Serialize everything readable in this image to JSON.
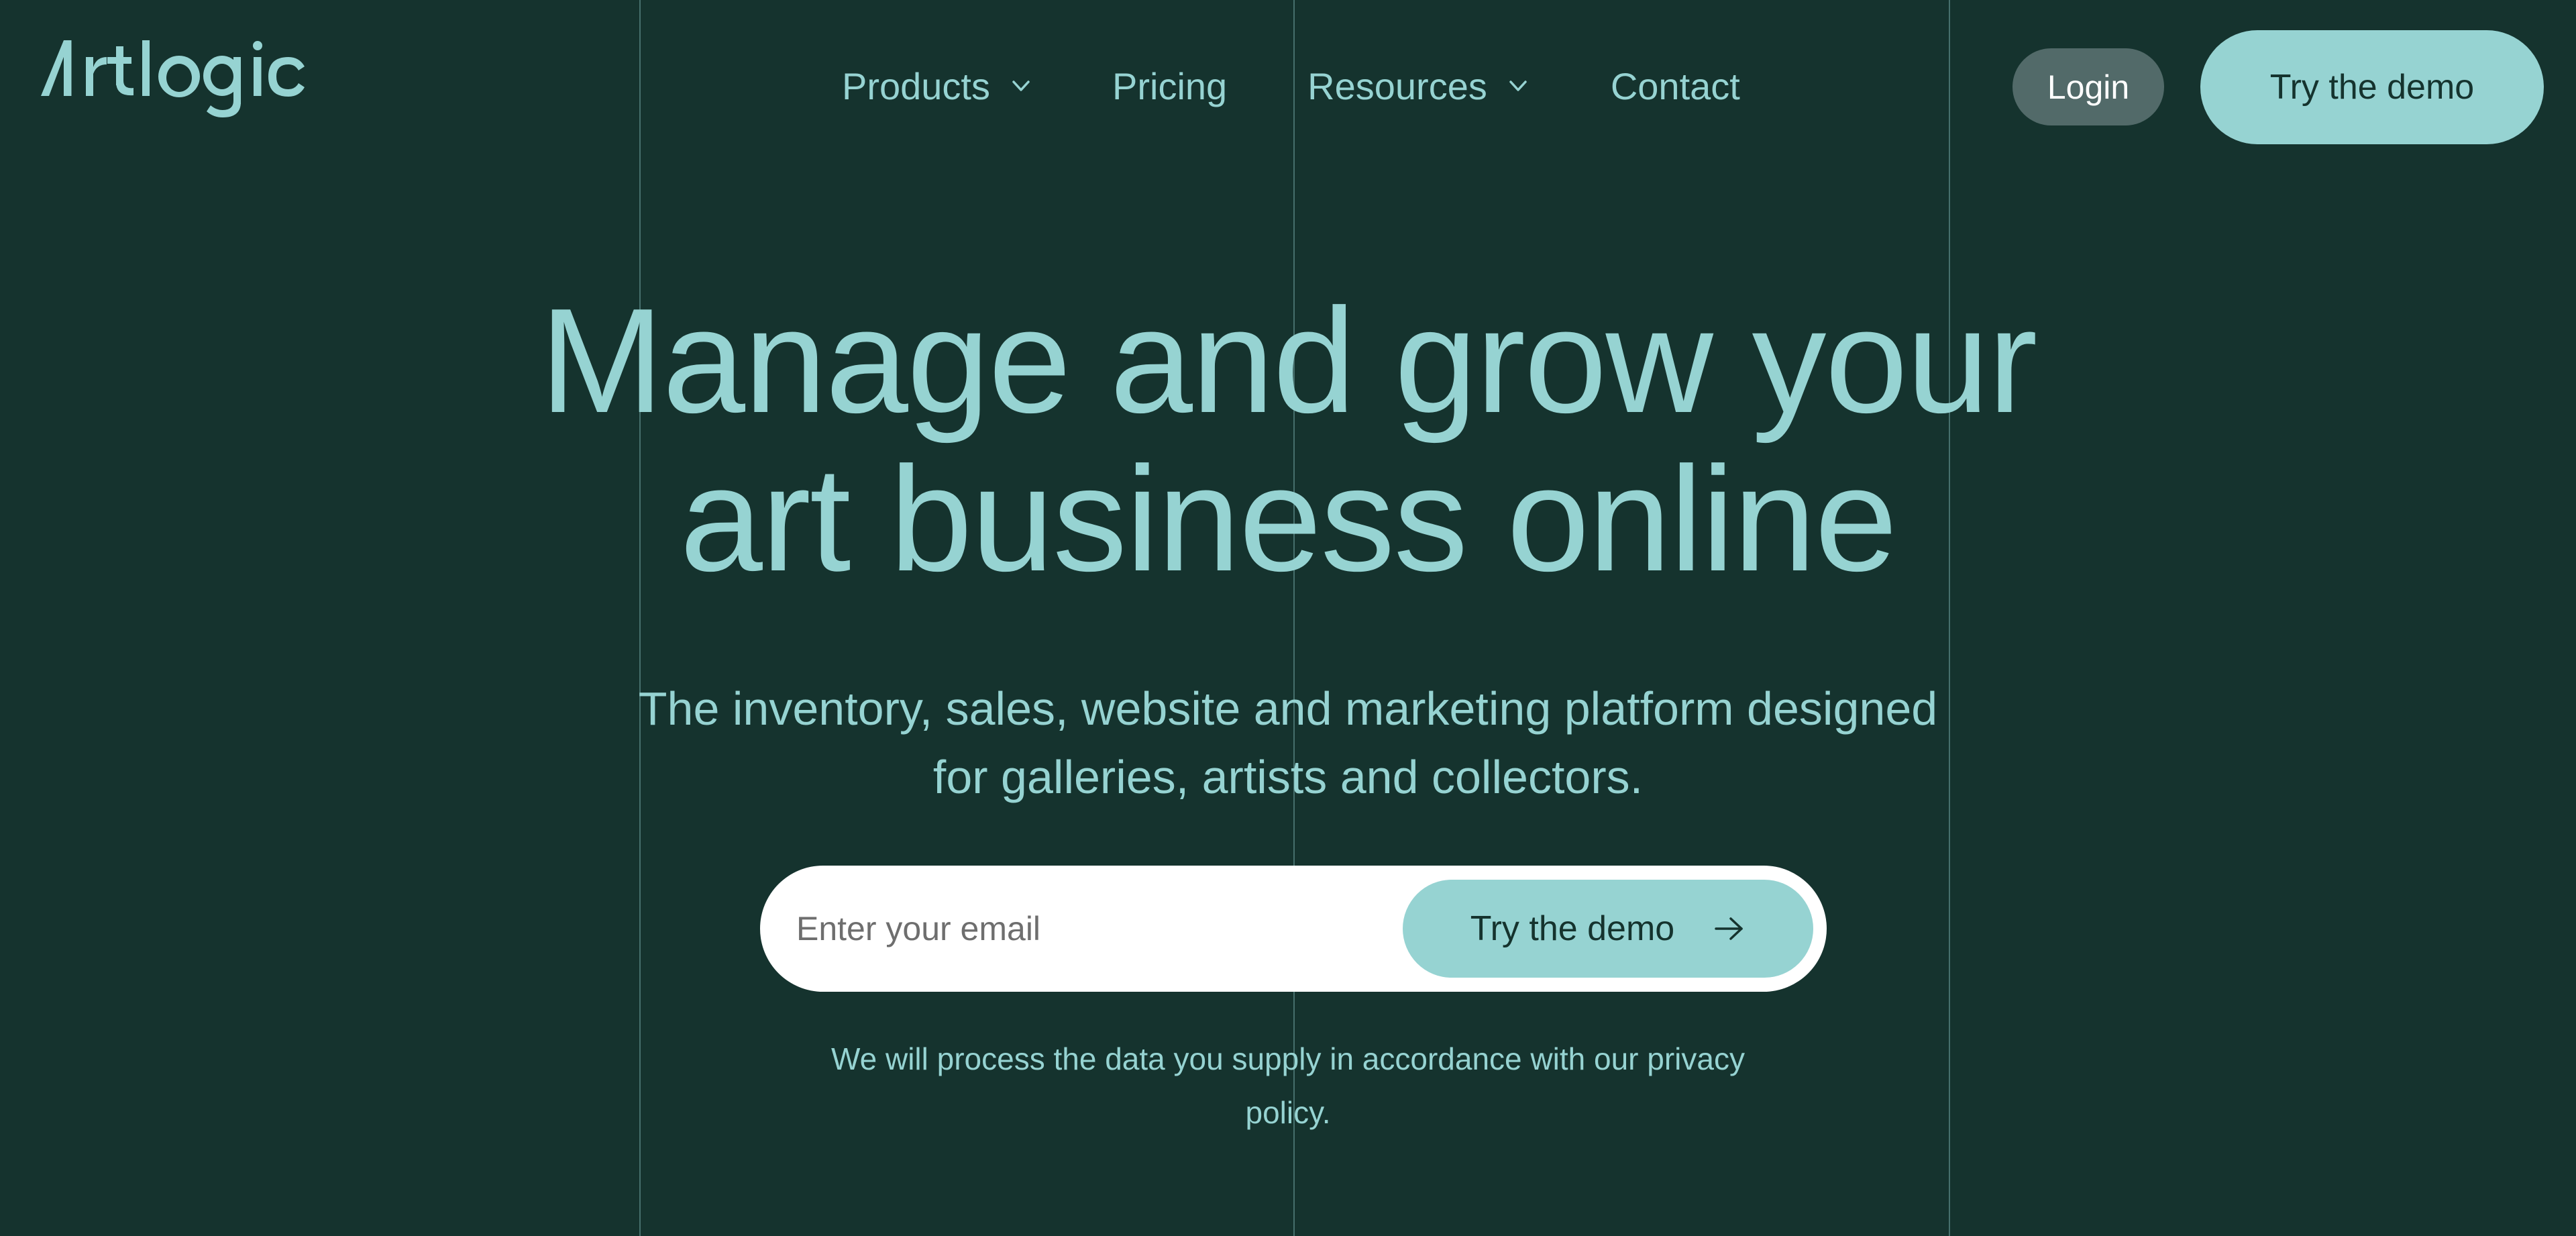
{
  "brand": {
    "name": "Artlogic",
    "colors": {
      "background": "#15332E",
      "accent": "#96D3D2",
      "login_button": "#526A69",
      "form_background": "#FFFFFF"
    }
  },
  "nav": {
    "items": [
      {
        "label": "Products",
        "has_dropdown": true,
        "icon": "chevron-down-icon"
      },
      {
        "label": "Pricing",
        "has_dropdown": false
      },
      {
        "label": "Resources",
        "has_dropdown": true,
        "icon": "chevron-down-icon"
      },
      {
        "label": "Contact",
        "has_dropdown": false
      }
    ],
    "login_label": "Login",
    "demo_label": "Try the demo"
  },
  "hero": {
    "headline_lines": [
      "Manage and grow your",
      "art business online"
    ],
    "subhead_lines": [
      "The inventory, sales, website and marketing platform designed",
      "for galleries, artists and collectors."
    ],
    "email_form": {
      "placeholder": "Enter your email",
      "value": "",
      "submit_label": "Try the demo",
      "submit_icon": "arrow-right-icon"
    },
    "disclaimer_lines": [
      "We will process the data you supply in accordance with our privacy",
      "policy."
    ]
  }
}
